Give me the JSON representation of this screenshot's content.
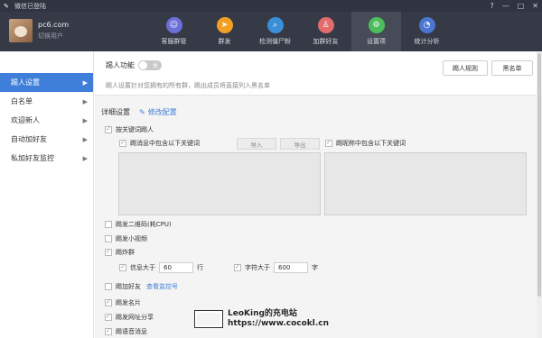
{
  "window": {
    "title": "微信已登陆",
    "controls": [
      "?",
      "—",
      "□",
      "✕"
    ]
  },
  "account": {
    "name": "pc6.com",
    "switch_label": "切换用户"
  },
  "tabs": [
    {
      "label": "客服群管",
      "icon": "chat-group-icon",
      "color": "#6c6fd8",
      "glyph": "☺"
    },
    {
      "label": "群发",
      "icon": "send-icon",
      "color": "#f2a024",
      "glyph": "➤"
    },
    {
      "label": "检测僵尸粉",
      "icon": "search-user-icon",
      "color": "#3b8fd8",
      "glyph": "⌕"
    },
    {
      "label": "加群好友",
      "icon": "add-friend-icon",
      "color": "#e36b6b",
      "glyph": "♙"
    },
    {
      "label": "设置项",
      "icon": "gear-icon",
      "color": "#4cbf5d",
      "glyph": "⚙"
    },
    {
      "label": "统计分析",
      "icon": "pie-chart-icon",
      "color": "#4a76d1",
      "glyph": "◔"
    }
  ],
  "sidebar": {
    "items": [
      {
        "label": "踢人设置",
        "active": true
      },
      {
        "label": "白名单"
      },
      {
        "label": "欢迎新人"
      },
      {
        "label": "自动加好友"
      },
      {
        "label": "私加好友监控"
      }
    ]
  },
  "kick": {
    "function_label": "踢人功能",
    "toggle_text": "关",
    "description": "踢人设置针对您拥有的所有群，踢出成员将直接列入黑名单",
    "rules_button": "踢人规则",
    "blacklist_button": "黑名单",
    "detail_label": "详细设置",
    "edit_link": "修改配置",
    "by_keyword": "按关键词踢人",
    "msg_keyword": "踢消息中包含以下关键词",
    "import": "导入",
    "export": "导出",
    "nick_keyword": "踢昵称中包含以下关键词",
    "qrcode": "踢发二维码(耗CPU)",
    "video": "踢发小视频",
    "spam_group": "踢炸群",
    "info_over": "信息大于",
    "info_value": "60",
    "info_unit": "行",
    "char_over": "字符大于",
    "char_value": "600",
    "char_unit": "字",
    "add_friend": "踢加好友",
    "monitor_link": "查看监控号",
    "card": "踢发名片",
    "share": "踢发网址分享",
    "more": "踢语音消息"
  },
  "watermark": {
    "line1": "LeoKing的充电站",
    "line2": "https://www.cocokl.cn"
  }
}
